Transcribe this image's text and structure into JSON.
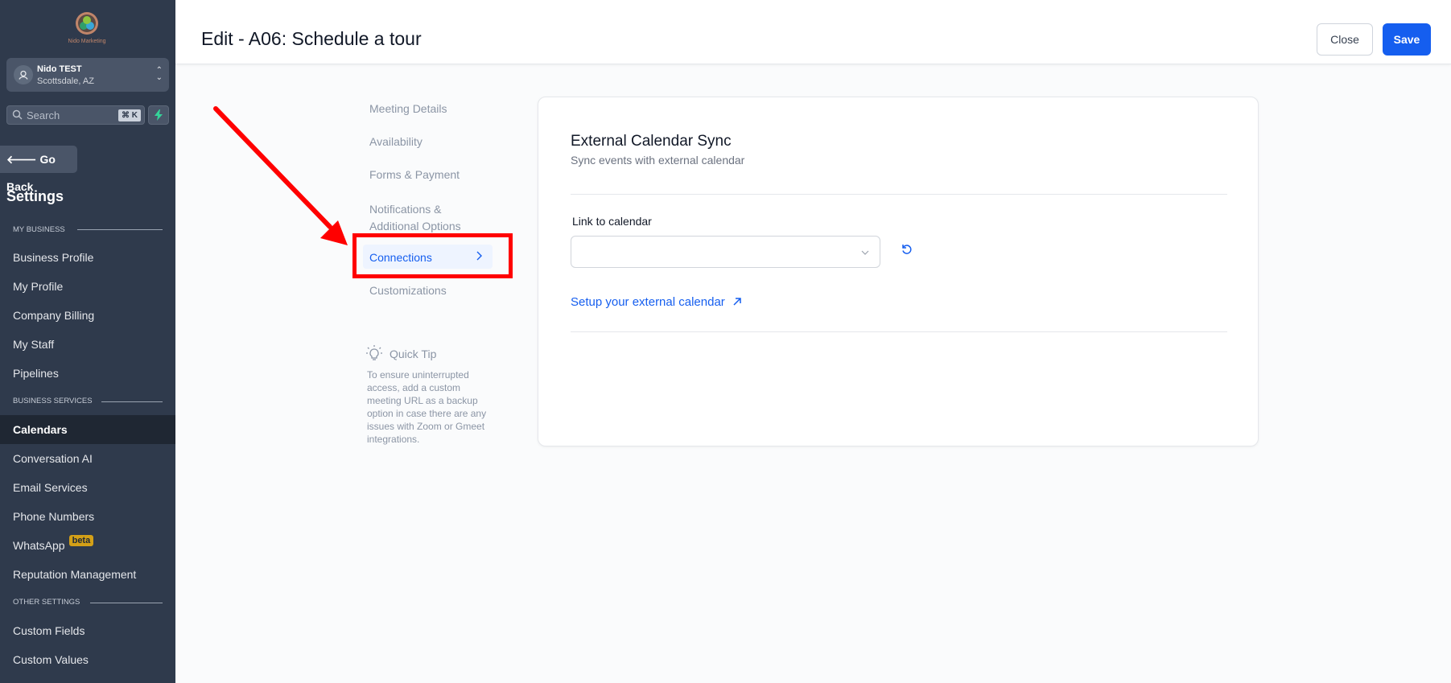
{
  "sidebar": {
    "logo_text": "Nido Marketing",
    "account_name": "Nido TEST",
    "account_location": "Scottsdale, AZ",
    "search_placeholder": "Search",
    "search_shortcut": "⌘ K",
    "go_back": "Go Back",
    "title": "Settings",
    "sections": {
      "my_business": "MY BUSINESS",
      "business_services": "BUSINESS SERVICES",
      "other_settings": "OTHER SETTINGS"
    },
    "items": [
      {
        "label": "Business Profile"
      },
      {
        "label": "My Profile"
      },
      {
        "label": "Company Billing"
      },
      {
        "label": "My Staff"
      },
      {
        "label": "Pipelines"
      },
      {
        "label": "Calendars",
        "active": true
      },
      {
        "label": "Conversation AI"
      },
      {
        "label": "Email Services"
      },
      {
        "label": "Phone Numbers"
      },
      {
        "label": "WhatsApp",
        "badge": "beta"
      },
      {
        "label": "Reputation Management"
      },
      {
        "label": "Custom Fields"
      },
      {
        "label": "Custom Values"
      }
    ]
  },
  "header": {
    "title": "Edit - A06: Schedule a tour",
    "close_label": "Close",
    "save_label": "Save"
  },
  "subnav": {
    "items": [
      {
        "label": "Meeting Details"
      },
      {
        "label": "Availability"
      },
      {
        "label": "Forms & Payment"
      },
      {
        "label": "Notifications & Additional Options"
      },
      {
        "label": "Connections",
        "active": true
      },
      {
        "label": "Customizations"
      }
    ],
    "quick_tip_title": "Quick Tip",
    "quick_tip_body": "To ensure uninterrupted access, add a custom meeting URL as a backup option in case there are any issues with Zoom or Gmeet integrations."
  },
  "card": {
    "title": "External Calendar Sync",
    "subtitle": "Sync events with external calendar",
    "field_label": "Link to calendar",
    "select_value": "",
    "setup_link": "Setup your external calendar"
  },
  "colors": {
    "sidebar_bg": "#2f3a4c",
    "accent": "#155eef",
    "annotation": "#ff0000",
    "beta_badge": "#d4a017"
  }
}
